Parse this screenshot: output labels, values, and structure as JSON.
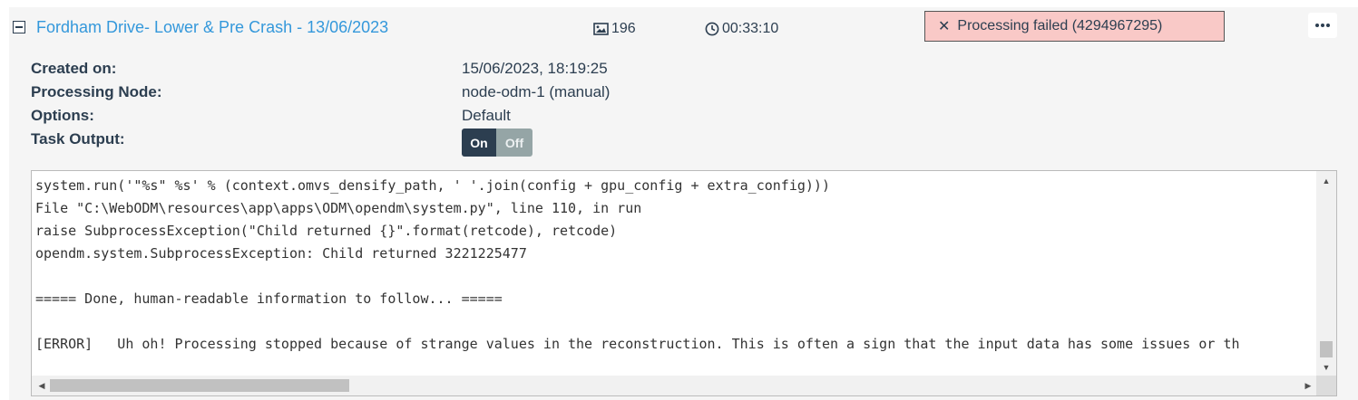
{
  "task": {
    "title": "Fordham Drive- Lower & Pre Crash - 13/06/2023",
    "image_count": "196",
    "elapsed": "00:33:10",
    "status": "Processing failed (4294967295)",
    "status_color": "#f9c9c7",
    "title_color": "#3498db"
  },
  "details": {
    "created_label": "Created on:",
    "created_value": "15/06/2023, 18:19:25",
    "node_label": "Processing Node:",
    "node_value": "node-odm-1 (manual)",
    "options_label": "Options:",
    "options_value": "Default",
    "output_label": "Task Output:",
    "toggle_on": "On",
    "toggle_off": "Off"
  },
  "console": {
    "lines": [
      "system.run('\"%s\" %s' % (context.omvs_densify_path, ' '.join(config + gpu_config + extra_config)))",
      "File \"C:\\WebODM\\resources\\app\\apps\\ODM\\opendm\\system.py\", line 110, in run",
      "raise SubprocessException(\"Child returned {}\".format(retcode), retcode)",
      "opendm.system.SubprocessException: Child returned 3221225477",
      "",
      "===== Done, human-readable information to follow... =====",
      "",
      "[ERROR]   Uh oh! Processing stopped because of strange values in the reconstruction. This is often a sign that the input data has some issues or th"
    ]
  },
  "icons": {
    "images": "image-icon",
    "time": "clock-icon",
    "status": "x-icon",
    "menu": "ellipsis-icon"
  }
}
